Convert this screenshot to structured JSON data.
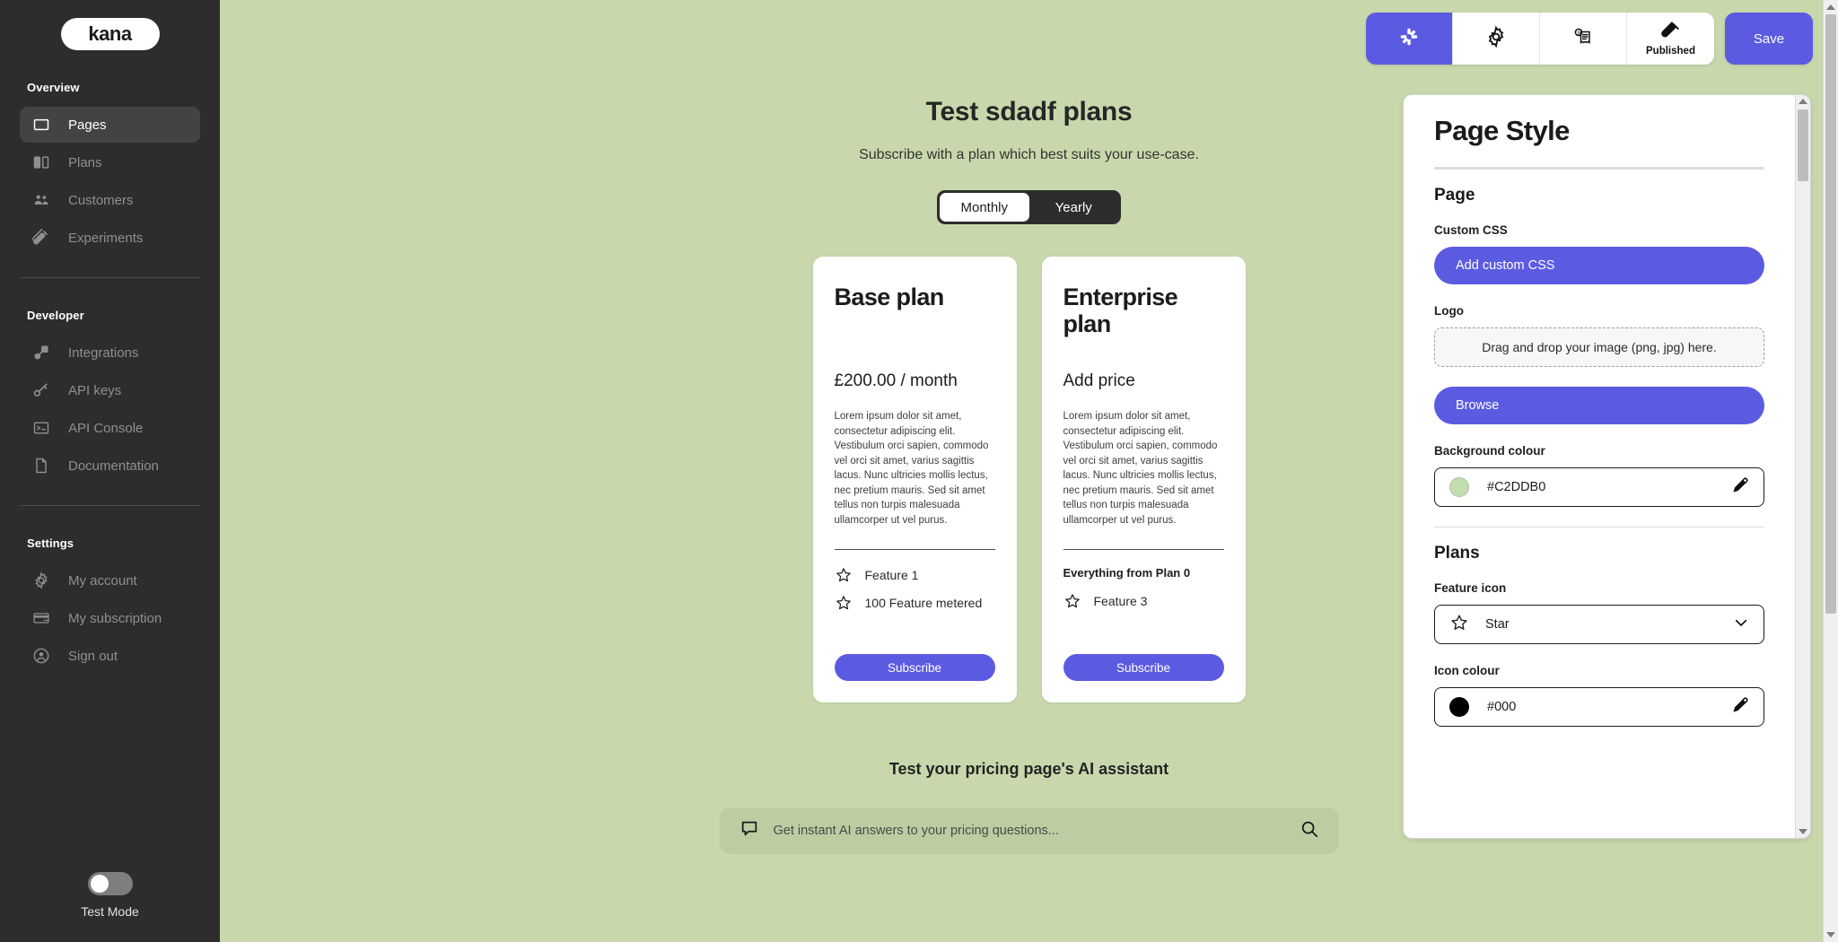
{
  "sidebar": {
    "logo_text": "kana",
    "sections": [
      {
        "heading": "Overview",
        "items": [
          {
            "label": "Pages",
            "icon": "window-icon",
            "active": true
          },
          {
            "label": "Plans",
            "icon": "columns-icon",
            "active": false
          },
          {
            "label": "Customers",
            "icon": "people-icon",
            "active": false
          },
          {
            "label": "Experiments",
            "icon": "test-tube-icon",
            "active": false
          }
        ]
      },
      {
        "heading": "Developer",
        "items": [
          {
            "label": "Integrations",
            "icon": "plug-icon",
            "active": false
          },
          {
            "label": "API keys",
            "icon": "key-icon",
            "active": false
          },
          {
            "label": "API Console",
            "icon": "terminal-icon",
            "active": false
          },
          {
            "label": "Documentation",
            "icon": "document-icon",
            "active": false
          }
        ]
      },
      {
        "heading": "Settings",
        "items": [
          {
            "label": "My account",
            "icon": "gear-icon",
            "active": false
          },
          {
            "label": "My subscription",
            "icon": "credit-card-icon",
            "active": false
          },
          {
            "label": "Sign out",
            "icon": "user-circle-icon",
            "active": false
          }
        ]
      }
    ],
    "test_mode_label": "Test Mode",
    "test_mode_on": false
  },
  "toolbar": {
    "buttons": [
      {
        "icon": "palette-icon",
        "label": "",
        "active": true
      },
      {
        "icon": "gear-icon",
        "label": "",
        "active": false
      },
      {
        "icon": "receipt-dollar-icon",
        "label": "",
        "active": false
      },
      {
        "icon": "test-tube-icon",
        "label": "Published",
        "active": false
      }
    ],
    "save_label": "Save"
  },
  "preview": {
    "title": "Test sdadf plans",
    "subtitle": "Subscribe with a plan which best suits your use-case.",
    "billing": {
      "options": [
        "Monthly",
        "Yearly"
      ],
      "selected": "Monthly"
    },
    "add_plan_label": "+",
    "plans": [
      {
        "name": "Base plan",
        "price": "£200.00 / month",
        "description": "Lorem ipsum dolor sit amet, consectetur adipiscing elit. Vestibulum orci sapien, commodo vel orci sit amet, varius sagittis lacus. Nunc ultricies mollis lectus, nec pretium mauris. Sed sit amet tellus non turpis malesuada ullamcorper ut vel purus.",
        "feature_note": "",
        "features": [
          "Feature 1",
          "100 Feature metered"
        ],
        "cta": "Subscribe"
      },
      {
        "name": "Enterprise plan",
        "price": "Add price",
        "description": "Lorem ipsum dolor sit amet, consectetur adipiscing elit. Vestibulum orci sapien, commodo vel orci sit amet, varius sagittis lacus. Nunc ultricies mollis lectus, nec pretium mauris. Sed sit amet tellus non turpis malesuada ullamcorper ut vel purus.",
        "feature_note": "Everything from Plan 0",
        "features": [
          "Feature 3"
        ],
        "cta": "Subscribe"
      }
    ],
    "ai": {
      "title": "Test your pricing page's AI assistant",
      "placeholder": "Get instant AI answers to your pricing questions..."
    }
  },
  "panel": {
    "title": "Page Style",
    "page_section": {
      "heading": "Page",
      "custom_css_label": "Custom CSS",
      "custom_css_button": "Add custom CSS",
      "logo_label": "Logo",
      "dropzone_text": "Drag and drop your image (png, jpg) here.",
      "browse_button": "Browse",
      "background_label": "Background colour",
      "background_value": "#C2DDB0",
      "background_swatch": "#c2ddb0"
    },
    "plans_section": {
      "heading": "Plans",
      "feature_icon_label": "Feature icon",
      "feature_icon_value": "Star",
      "icon_colour_label": "Icon colour",
      "icon_colour_value": "#000",
      "icon_colour_swatch": "#000000"
    }
  },
  "colors": {
    "accent": "#5B5BE2",
    "sidebar_bg": "#2D2D2D",
    "canvas_bg": "#C2DDB0"
  }
}
